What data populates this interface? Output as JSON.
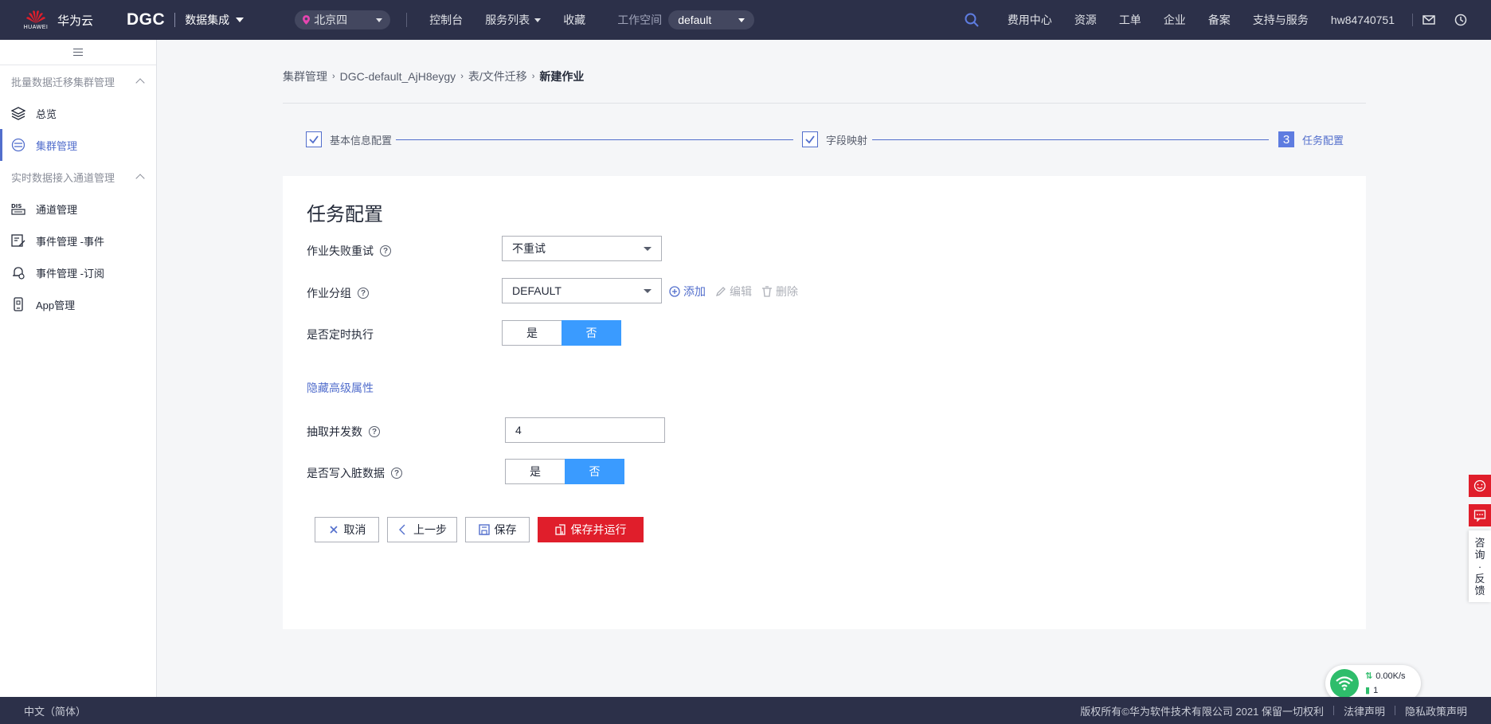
{
  "topnav": {
    "brand_name": "华为云",
    "logo_text": "HUAWEI",
    "product": "DGC",
    "service": "数据集成",
    "region": "北京四",
    "links": [
      "控制台",
      "服务列表",
      "收藏"
    ],
    "workspace_label": "工作空间",
    "workspace_value": "default",
    "right_links": [
      "费用中心",
      "资源",
      "工单",
      "企业",
      "备案",
      "支持与服务"
    ],
    "user": "hw84740751"
  },
  "sidebar": {
    "section1": "批量数据迁移集群管理",
    "section1_items": [
      "总览",
      "集群管理"
    ],
    "section2": "实时数据接入通道管理",
    "section2_items": [
      "通道管理",
      "事件管理 -事件",
      "事件管理 -订阅",
      "App管理"
    ]
  },
  "breadcrumb": [
    "集群管理",
    "DGC-default_AjH8eygy",
    "表/文件迁移",
    "新建作业"
  ],
  "steps": {
    "step1": "基本信息配置",
    "step2": "字段映射",
    "step3_num": "3",
    "step3": "任务配置"
  },
  "form": {
    "title": "任务配置",
    "retry_label": "作业失败重试",
    "retry_value": "不重试",
    "group_label": "作业分组",
    "group_value": "DEFAULT",
    "add": "添加",
    "edit": "编辑",
    "delete": "删除",
    "schedule_label": "是否定时执行",
    "yes": "是",
    "no": "否",
    "adv_link": "隐藏高级属性",
    "concurrency_label": "抽取并发数",
    "concurrency_value": "4",
    "dirty_label": "是否写入脏数据"
  },
  "buttons": {
    "cancel": "取消",
    "prev": "上一步",
    "save": "保存",
    "save_run": "保存并运行"
  },
  "float": {
    "text": [
      "咨",
      "询",
      "·",
      "反",
      "馈"
    ]
  },
  "net_widget": {
    "speed": "0.00K/s",
    "count": "1"
  },
  "footer": {
    "lang": "中文（简体）",
    "copyright": "版权所有©华为软件技术有限公司 2021 保留一切权利",
    "legal": "法律声明",
    "privacy": "隐私政策声明"
  },
  "colors": {
    "nav_bg": "#2c3049",
    "accent": "#526ecc",
    "primary_red": "#e01e2b",
    "toggle_on": "#3a9bff"
  }
}
